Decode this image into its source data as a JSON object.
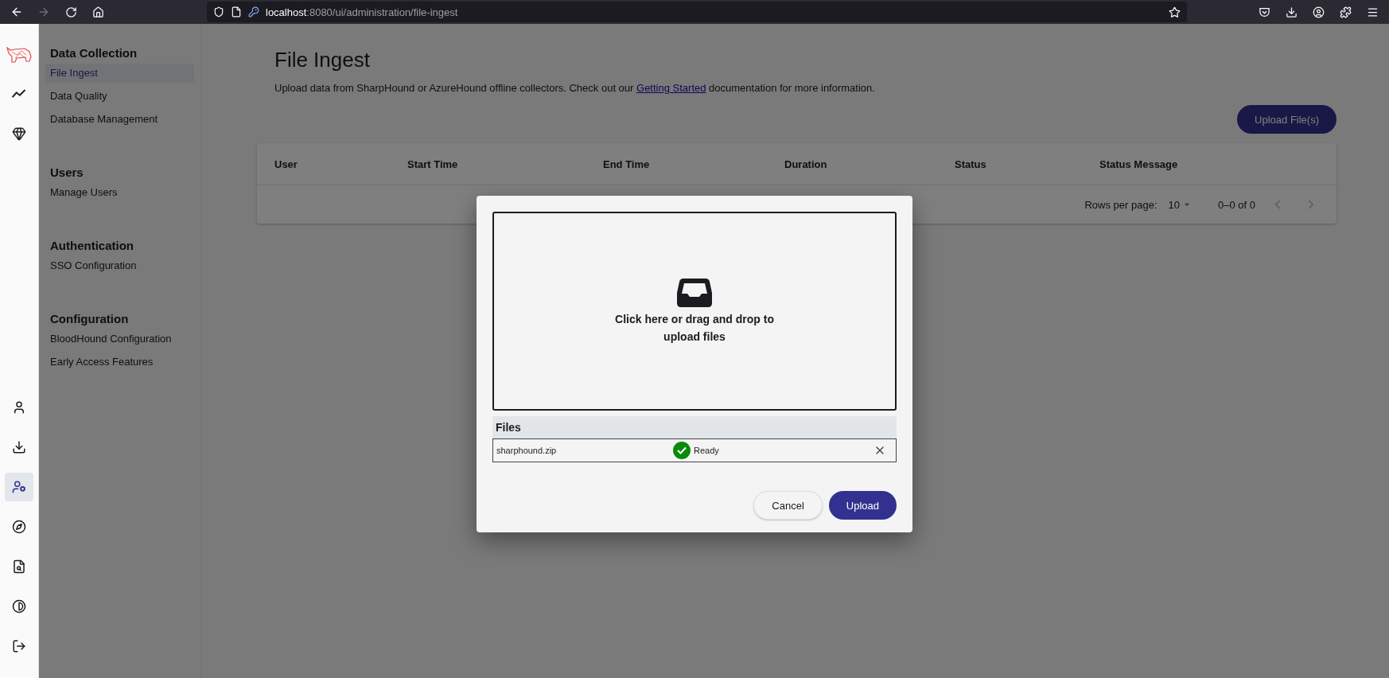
{
  "browser": {
    "back_disabled": false,
    "forward_disabled": true,
    "url_host": "localhost",
    "url_path": ":8080/ui/administration/file-ingest"
  },
  "rail": {
    "items": [
      {
        "selected": false
      },
      {
        "selected": false
      },
      {
        "selected": false
      },
      {
        "selected": false
      },
      {
        "selected": true
      },
      {
        "selected": false
      },
      {
        "selected": false
      },
      {
        "selected": false
      },
      {
        "selected": false
      }
    ]
  },
  "nav": {
    "sections": [
      {
        "heading": "Data Collection",
        "items": [
          {
            "label": "File Ingest",
            "selected": true
          },
          {
            "label": "Data Quality",
            "selected": false
          },
          {
            "label": "Database Management",
            "selected": false
          }
        ]
      },
      {
        "heading": "Users",
        "items": [
          {
            "label": "Manage Users",
            "selected": false
          }
        ]
      },
      {
        "heading": "Authentication",
        "items": [
          {
            "label": "SSO Configuration",
            "selected": false
          }
        ]
      },
      {
        "heading": "Configuration",
        "items": [
          {
            "label": "BloodHound Configuration",
            "selected": false
          },
          {
            "label": "Early Access Features",
            "selected": false
          }
        ]
      }
    ]
  },
  "page": {
    "title": "File Ingest",
    "description_before": "Upload data from SharpHound or AzureHound offline collectors. Check out our ",
    "description_link": "Getting Started",
    "description_after": " documentation for more information.",
    "upload_button": "Upload File(s)"
  },
  "table": {
    "columns": [
      "User",
      "Start Time",
      "End Time",
      "Duration",
      "Status",
      "Status Message"
    ],
    "rows_per_page_label": "Rows per page:",
    "rows_per_page": "10",
    "range": "0–0 of 0",
    "prev_disabled": true,
    "next_disabled": true
  },
  "dialog": {
    "dropzone_text": "Click here or drag and drop to upload files",
    "files_heading": "Files",
    "files": [
      {
        "name": "sharphound.zip",
        "status": "Ready",
        "kind": "ready"
      }
    ],
    "cancel": "Cancel",
    "upload": "Upload"
  }
}
